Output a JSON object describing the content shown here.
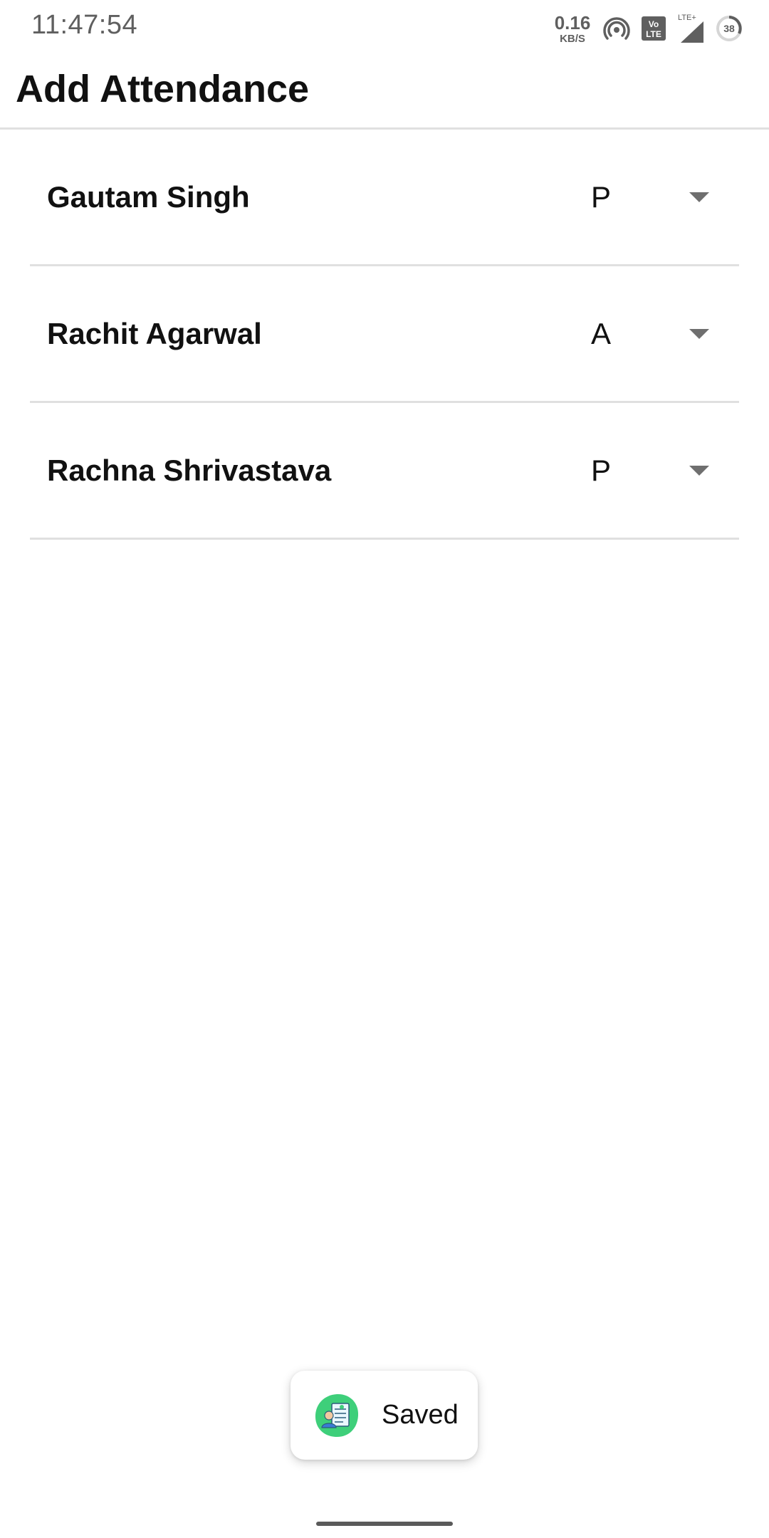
{
  "status_bar": {
    "time": "11:47:54",
    "network_speed": "0.16",
    "network_speed_unit": "KB/S",
    "volte_label": "Vo LTE",
    "lte_label": "LTE+",
    "battery_level": "38",
    "icons": [
      "hotspot-icon",
      "volte-icon",
      "signal-icon",
      "battery-icon"
    ]
  },
  "app_bar": {
    "title": "Add Attendance"
  },
  "attendance": [
    {
      "name": "Gautam Singh",
      "status": "P"
    },
    {
      "name": "Rachit Agarwal",
      "status": "A"
    },
    {
      "name": "Rachna Shrivastava",
      "status": "P"
    }
  ],
  "toast": {
    "message": "Saved",
    "icon": "app-logo-icon"
  },
  "colors": {
    "divider": "#e0e0e0",
    "text": "#111111",
    "status_bar_text": "#5f5f5f",
    "toast_icon_bg": "#3ecf7a"
  }
}
